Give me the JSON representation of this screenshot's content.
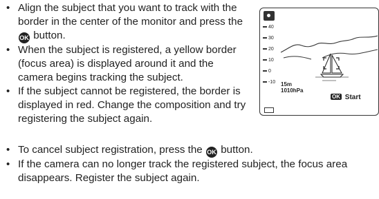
{
  "bullets_top": [
    {
      "before": "Align the subject that you want to track with the border in the center of the monitor and press the",
      "after": "button."
    },
    {
      "text": "When the subject is registered, a yellow border (focus area) is displayed around it and the camera begins tracking the subject."
    },
    {
      "text": "If the subject cannot be registered, the border is displayed in red. Change the composition and try registering the subject again."
    }
  ],
  "bullets_bottom": [
    {
      "before": "To cancel subject registration, press the",
      "after": "button."
    },
    {
      "text": "If the camera can no longer track the registered subject, the focus area disappears. Register the subject again."
    }
  ],
  "ok_button_label": "OK",
  "monitor": {
    "scale": [
      "40",
      "30",
      "20",
      "10",
      "0",
      "-10"
    ],
    "altitude": "15m",
    "pressure": "1010hPa",
    "start_button": "OK",
    "start_label": "Start"
  }
}
